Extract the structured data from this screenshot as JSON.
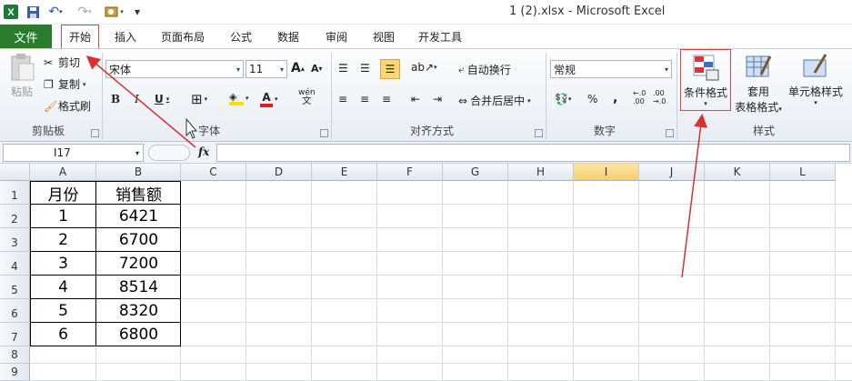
{
  "window": {
    "title": "1 (2).xlsx  -  Microsoft Excel"
  },
  "quick_access": {
    "excel_icon": "X",
    "save_icon": "save",
    "undo": "↶",
    "redo": "↷",
    "customize": "▾"
  },
  "tabs": {
    "file": "文件",
    "items": [
      {
        "label": "开始"
      },
      {
        "label": "插入"
      },
      {
        "label": "页面布局"
      },
      {
        "label": "公式"
      },
      {
        "label": "数据"
      },
      {
        "label": "审阅"
      },
      {
        "label": "视图"
      },
      {
        "label": "开发工具"
      }
    ]
  },
  "ribbon": {
    "clipboard": {
      "paste": "粘贴",
      "cut": "剪切",
      "copy": "复制",
      "format_painter": "格式刷",
      "group": "剪贴板"
    },
    "font": {
      "name": "宋体",
      "size": "11",
      "bold": "B",
      "italic": "I",
      "underline": "U",
      "grow": "A",
      "shrink": "A",
      "wen": "wén",
      "group": "字体"
    },
    "alignment": {
      "wrap": "自动换行",
      "merge": "合并后居中",
      "group": "对齐方式"
    },
    "number": {
      "format": "常规",
      "percent": "%",
      "comma": ",",
      "inc_decimal": "←.0\n.00",
      "dec_decimal": ".00\n→.0",
      "group": "数字"
    },
    "styles": {
      "conditional": "条件格式",
      "table_line1": "套用",
      "table_line2": "表格格式",
      "cell_styles": "单元格样式",
      "group": "样式"
    }
  },
  "formula_bar": {
    "cell_ref": "I17",
    "fx": "fx",
    "content": ""
  },
  "columns": [
    "A",
    "B",
    "C",
    "D",
    "E",
    "F",
    "G",
    "H",
    "I",
    "J",
    "K",
    "L"
  ],
  "selected_column": "I",
  "rows": [
    "1",
    "2",
    "3",
    "4",
    "5",
    "6",
    "7",
    "8",
    "9"
  ],
  "table": {
    "header": [
      "月份",
      "销售额"
    ],
    "data": [
      [
        "1",
        "6421"
      ],
      [
        "2",
        "6700"
      ],
      [
        "3",
        "7200"
      ],
      [
        "4",
        "8514"
      ],
      [
        "5",
        "8320"
      ],
      [
        "6",
        "6800"
      ]
    ]
  },
  "annotation_color": "#d93030",
  "file_tab_color": "#2b7b2f"
}
